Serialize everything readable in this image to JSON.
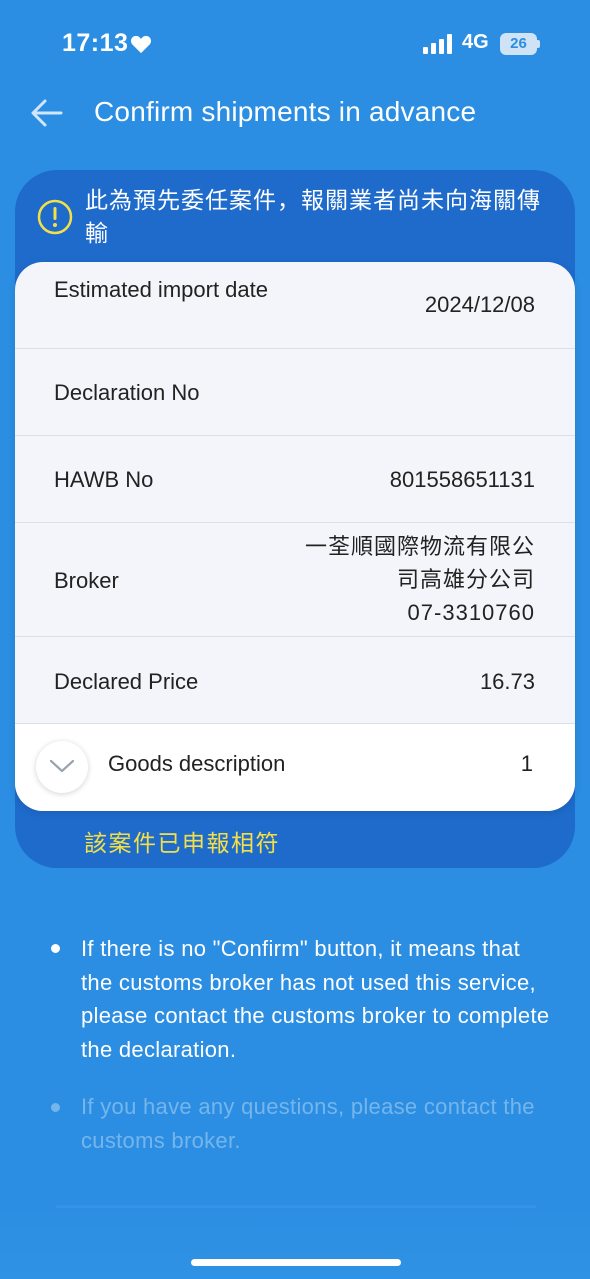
{
  "status_bar": {
    "time": "17:13",
    "network": "4G",
    "battery": "26"
  },
  "header": {
    "title": "Confirm shipments in advance"
  },
  "notice": {
    "warning_text": "此為預先委任案件，報關業者尚未向海關傳輸",
    "status_text": "該案件已申報相符"
  },
  "details": {
    "rows": [
      {
        "label": "Estimated import date",
        "value": "2024/12/08"
      },
      {
        "label": "Declaration No",
        "value": ""
      },
      {
        "label": "HAWB No",
        "value": "801558651131"
      },
      {
        "label": "Broker",
        "value": "一荃順國際物流有限公司高雄分公司\n07-3310760"
      },
      {
        "label": "Declared Price",
        "value": "16.73"
      }
    ],
    "goods": {
      "label": "Goods description",
      "value": "1"
    }
  },
  "notes": [
    "If there is no \"Confirm\" button, it means that the customs broker has not used this service, please contact the customs broker to complete the declaration.",
    "If you have any questions, please contact the customs broker."
  ],
  "colors": {
    "background": "#2b8ee2",
    "card_blue": "#1e6bcc",
    "status_yellow": "#f4e046",
    "warning_icon": "#f4e046"
  }
}
